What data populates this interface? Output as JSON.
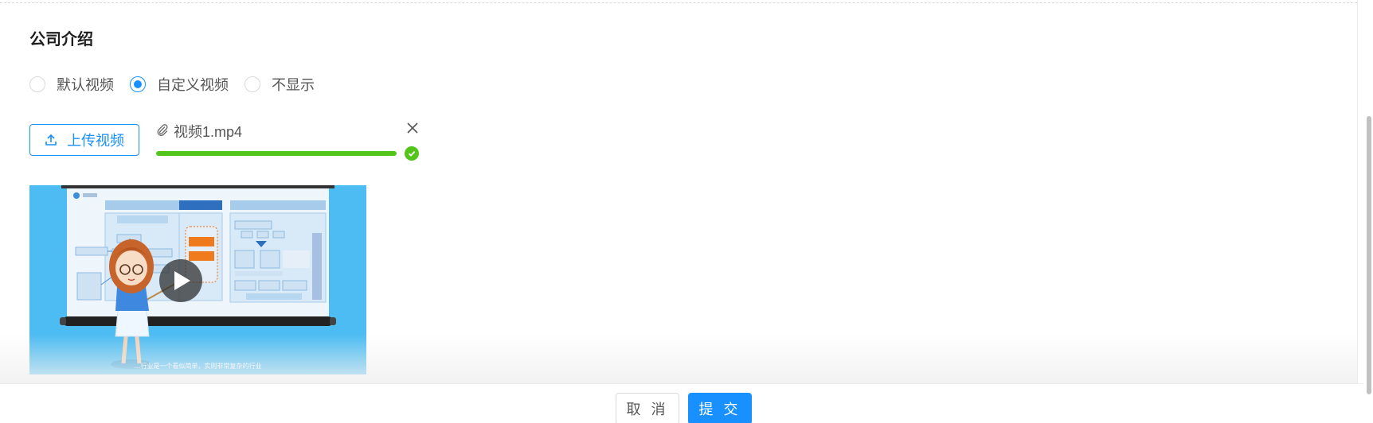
{
  "section": {
    "title": "公司介绍"
  },
  "video_source": {
    "options": [
      {
        "label": "默认视频",
        "checked": false
      },
      {
        "label": "自定义视频",
        "checked": true
      },
      {
        "label": "不显示",
        "checked": false
      }
    ]
  },
  "upload": {
    "button_label": "上传视频",
    "file": {
      "name": "视频1.mp4",
      "progress": 1.0,
      "status": "success"
    }
  },
  "video_preview": {
    "caption": "…行业是一个看似简单，实则非常复杂的行业"
  },
  "footer": {
    "cancel_label": "取 消",
    "submit_label": "提 交"
  },
  "colors": {
    "primary": "#1890ff",
    "success": "#52c41a",
    "video_bg": "#4cbcf2"
  },
  "icons": {
    "upload": "upload-icon",
    "attachment": "paperclip-icon",
    "remove": "close-icon",
    "done": "check-circle-icon",
    "play": "play-icon"
  }
}
